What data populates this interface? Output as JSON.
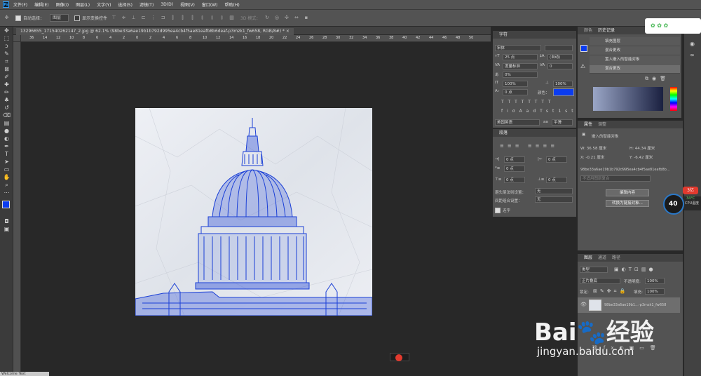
{
  "menu": [
    "文件(F)",
    "编辑(E)",
    "图像(I)",
    "图层(L)",
    "文字(Y)",
    "选择(S)",
    "滤镜(T)",
    "3D(D)",
    "视图(V)",
    "窗口(W)",
    "帮助(H)"
  ],
  "options": {
    "auto_select": "自动选择：",
    "auto_select_value": "图层",
    "show_transform": "显示变换控件",
    "mode_3d": "3D 模式："
  },
  "document_tab": "13296655_171540262147_2.jpg @ 62.1% (98be33a6ae19b1b792d995ea4cb4f5ae81eafb8b6deaf-p3mzk1_fw658, RGB/8#) *",
  "ruler_ticks": [
    "36",
    "14",
    "12",
    "10",
    "8",
    "6",
    "4",
    "2",
    "0",
    "2",
    "4",
    "6",
    "8",
    "10",
    "12",
    "14",
    "16",
    "18",
    "20",
    "22",
    "24",
    "26",
    "28",
    "30",
    "32",
    "34",
    "36",
    "38",
    "40",
    "42",
    "44",
    "46",
    "48",
    "50"
  ],
  "character_panel": {
    "tab": "字符",
    "font": "宋体",
    "size": "25 点",
    "leading": "(自动)",
    "kerning": "度量标准",
    "tracking": "0",
    "scale_pct": "0%",
    "vscale": "100%",
    "hscale": "100%",
    "baseline": "0 点",
    "color_label": "颜色：",
    "lang": "美国英语",
    "aa": "平滑"
  },
  "paragraph_panel": {
    "tab": "段落",
    "indent_left": "0 点",
    "indent_right": "0 点",
    "indent_first": "0 点",
    "space_before": "0 点",
    "space_after": "0 点",
    "avoid_label": "避头尾法则设置：",
    "avoid_value": "无",
    "spacing_label": "间距组合设置：",
    "spacing_value": "无",
    "hyphen": "连字"
  },
  "history_panel": {
    "tab": "历史记录",
    "items": [
      "填充图层",
      "混合更改",
      "置入嵌入的智能对象",
      "混合更改"
    ]
  },
  "properties_panel": {
    "tabs": [
      "属性",
      "调整"
    ],
    "type": "嵌入的智能对象",
    "w": "W:  36.58 厘米",
    "h": "H:  44.34 厘米",
    "x": "X:  -0.21 厘米",
    "y": "Y:  -6.42 厘米",
    "filename": "98be33a6ae19b1b792d995ea4cb4f5ae81eafb8b...",
    "comp": "不适用图层复合",
    "edit_btn": "编辑内容",
    "convert_btn": "转换为链接对象..."
  },
  "layers_panel": {
    "tabs": [
      "图层",
      "通道",
      "路径"
    ],
    "filter": "类型",
    "blend": "正片叠底",
    "opacity_label": "不透明度:",
    "opacity": "100%",
    "lock_label": "锁定:",
    "fill_label": "填充:",
    "fill": "100%",
    "layer_name": "98be33a6ae19b1...-p3mzk1_fw658"
  },
  "perf_widget": {
    "percent": "40",
    "temp": "34°C",
    "cpu": "CPU温度",
    "badge": "3亿"
  },
  "watermark": {
    "brand": "Bai",
    "brand2": "经验",
    "url": "jingyan.baidu.com"
  },
  "status": {
    "bottom_left": "Welcome Text"
  },
  "colors": {
    "fg": "#0b3cf0",
    "accent": "#2fa3ff",
    "sketch": "#1a3fd6"
  }
}
